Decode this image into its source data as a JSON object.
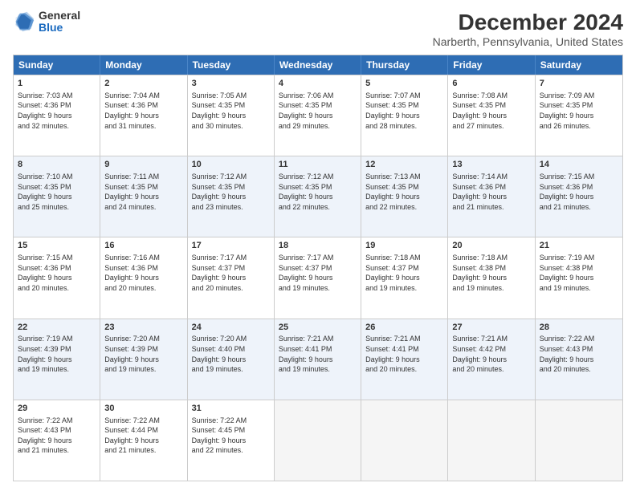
{
  "logo": {
    "general": "General",
    "blue": "Blue"
  },
  "title": "December 2024",
  "subtitle": "Narberth, Pennsylvania, United States",
  "header_days": [
    "Sunday",
    "Monday",
    "Tuesday",
    "Wednesday",
    "Thursday",
    "Friday",
    "Saturday"
  ],
  "weeks": [
    [
      {
        "day": "1",
        "lines": [
          "Sunrise: 7:03 AM",
          "Sunset: 4:36 PM",
          "Daylight: 9 hours",
          "and 32 minutes."
        ]
      },
      {
        "day": "2",
        "lines": [
          "Sunrise: 7:04 AM",
          "Sunset: 4:36 PM",
          "Daylight: 9 hours",
          "and 31 minutes."
        ]
      },
      {
        "day": "3",
        "lines": [
          "Sunrise: 7:05 AM",
          "Sunset: 4:35 PM",
          "Daylight: 9 hours",
          "and 30 minutes."
        ]
      },
      {
        "day": "4",
        "lines": [
          "Sunrise: 7:06 AM",
          "Sunset: 4:35 PM",
          "Daylight: 9 hours",
          "and 29 minutes."
        ]
      },
      {
        "day": "5",
        "lines": [
          "Sunrise: 7:07 AM",
          "Sunset: 4:35 PM",
          "Daylight: 9 hours",
          "and 28 minutes."
        ]
      },
      {
        "day": "6",
        "lines": [
          "Sunrise: 7:08 AM",
          "Sunset: 4:35 PM",
          "Daylight: 9 hours",
          "and 27 minutes."
        ]
      },
      {
        "day": "7",
        "lines": [
          "Sunrise: 7:09 AM",
          "Sunset: 4:35 PM",
          "Daylight: 9 hours",
          "and 26 minutes."
        ]
      }
    ],
    [
      {
        "day": "8",
        "lines": [
          "Sunrise: 7:10 AM",
          "Sunset: 4:35 PM",
          "Daylight: 9 hours",
          "and 25 minutes."
        ]
      },
      {
        "day": "9",
        "lines": [
          "Sunrise: 7:11 AM",
          "Sunset: 4:35 PM",
          "Daylight: 9 hours",
          "and 24 minutes."
        ]
      },
      {
        "day": "10",
        "lines": [
          "Sunrise: 7:12 AM",
          "Sunset: 4:35 PM",
          "Daylight: 9 hours",
          "and 23 minutes."
        ]
      },
      {
        "day": "11",
        "lines": [
          "Sunrise: 7:12 AM",
          "Sunset: 4:35 PM",
          "Daylight: 9 hours",
          "and 22 minutes."
        ]
      },
      {
        "day": "12",
        "lines": [
          "Sunrise: 7:13 AM",
          "Sunset: 4:35 PM",
          "Daylight: 9 hours",
          "and 22 minutes."
        ]
      },
      {
        "day": "13",
        "lines": [
          "Sunrise: 7:14 AM",
          "Sunset: 4:36 PM",
          "Daylight: 9 hours",
          "and 21 minutes."
        ]
      },
      {
        "day": "14",
        "lines": [
          "Sunrise: 7:15 AM",
          "Sunset: 4:36 PM",
          "Daylight: 9 hours",
          "and 21 minutes."
        ]
      }
    ],
    [
      {
        "day": "15",
        "lines": [
          "Sunrise: 7:15 AM",
          "Sunset: 4:36 PM",
          "Daylight: 9 hours",
          "and 20 minutes."
        ]
      },
      {
        "day": "16",
        "lines": [
          "Sunrise: 7:16 AM",
          "Sunset: 4:36 PM",
          "Daylight: 9 hours",
          "and 20 minutes."
        ]
      },
      {
        "day": "17",
        "lines": [
          "Sunrise: 7:17 AM",
          "Sunset: 4:37 PM",
          "Daylight: 9 hours",
          "and 20 minutes."
        ]
      },
      {
        "day": "18",
        "lines": [
          "Sunrise: 7:17 AM",
          "Sunset: 4:37 PM",
          "Daylight: 9 hours",
          "and 19 minutes."
        ]
      },
      {
        "day": "19",
        "lines": [
          "Sunrise: 7:18 AM",
          "Sunset: 4:37 PM",
          "Daylight: 9 hours",
          "and 19 minutes."
        ]
      },
      {
        "day": "20",
        "lines": [
          "Sunrise: 7:18 AM",
          "Sunset: 4:38 PM",
          "Daylight: 9 hours",
          "and 19 minutes."
        ]
      },
      {
        "day": "21",
        "lines": [
          "Sunrise: 7:19 AM",
          "Sunset: 4:38 PM",
          "Daylight: 9 hours",
          "and 19 minutes."
        ]
      }
    ],
    [
      {
        "day": "22",
        "lines": [
          "Sunrise: 7:19 AM",
          "Sunset: 4:39 PM",
          "Daylight: 9 hours",
          "and 19 minutes."
        ]
      },
      {
        "day": "23",
        "lines": [
          "Sunrise: 7:20 AM",
          "Sunset: 4:39 PM",
          "Daylight: 9 hours",
          "and 19 minutes."
        ]
      },
      {
        "day": "24",
        "lines": [
          "Sunrise: 7:20 AM",
          "Sunset: 4:40 PM",
          "Daylight: 9 hours",
          "and 19 minutes."
        ]
      },
      {
        "day": "25",
        "lines": [
          "Sunrise: 7:21 AM",
          "Sunset: 4:41 PM",
          "Daylight: 9 hours",
          "and 19 minutes."
        ]
      },
      {
        "day": "26",
        "lines": [
          "Sunrise: 7:21 AM",
          "Sunset: 4:41 PM",
          "Daylight: 9 hours",
          "and 20 minutes."
        ]
      },
      {
        "day": "27",
        "lines": [
          "Sunrise: 7:21 AM",
          "Sunset: 4:42 PM",
          "Daylight: 9 hours",
          "and 20 minutes."
        ]
      },
      {
        "day": "28",
        "lines": [
          "Sunrise: 7:22 AM",
          "Sunset: 4:43 PM",
          "Daylight: 9 hours",
          "and 20 minutes."
        ]
      }
    ],
    [
      {
        "day": "29",
        "lines": [
          "Sunrise: 7:22 AM",
          "Sunset: 4:43 PM",
          "Daylight: 9 hours",
          "and 21 minutes."
        ]
      },
      {
        "day": "30",
        "lines": [
          "Sunrise: 7:22 AM",
          "Sunset: 4:44 PM",
          "Daylight: 9 hours",
          "and 21 minutes."
        ]
      },
      {
        "day": "31",
        "lines": [
          "Sunrise: 7:22 AM",
          "Sunset: 4:45 PM",
          "Daylight: 9 hours",
          "and 22 minutes."
        ]
      },
      null,
      null,
      null,
      null
    ]
  ]
}
